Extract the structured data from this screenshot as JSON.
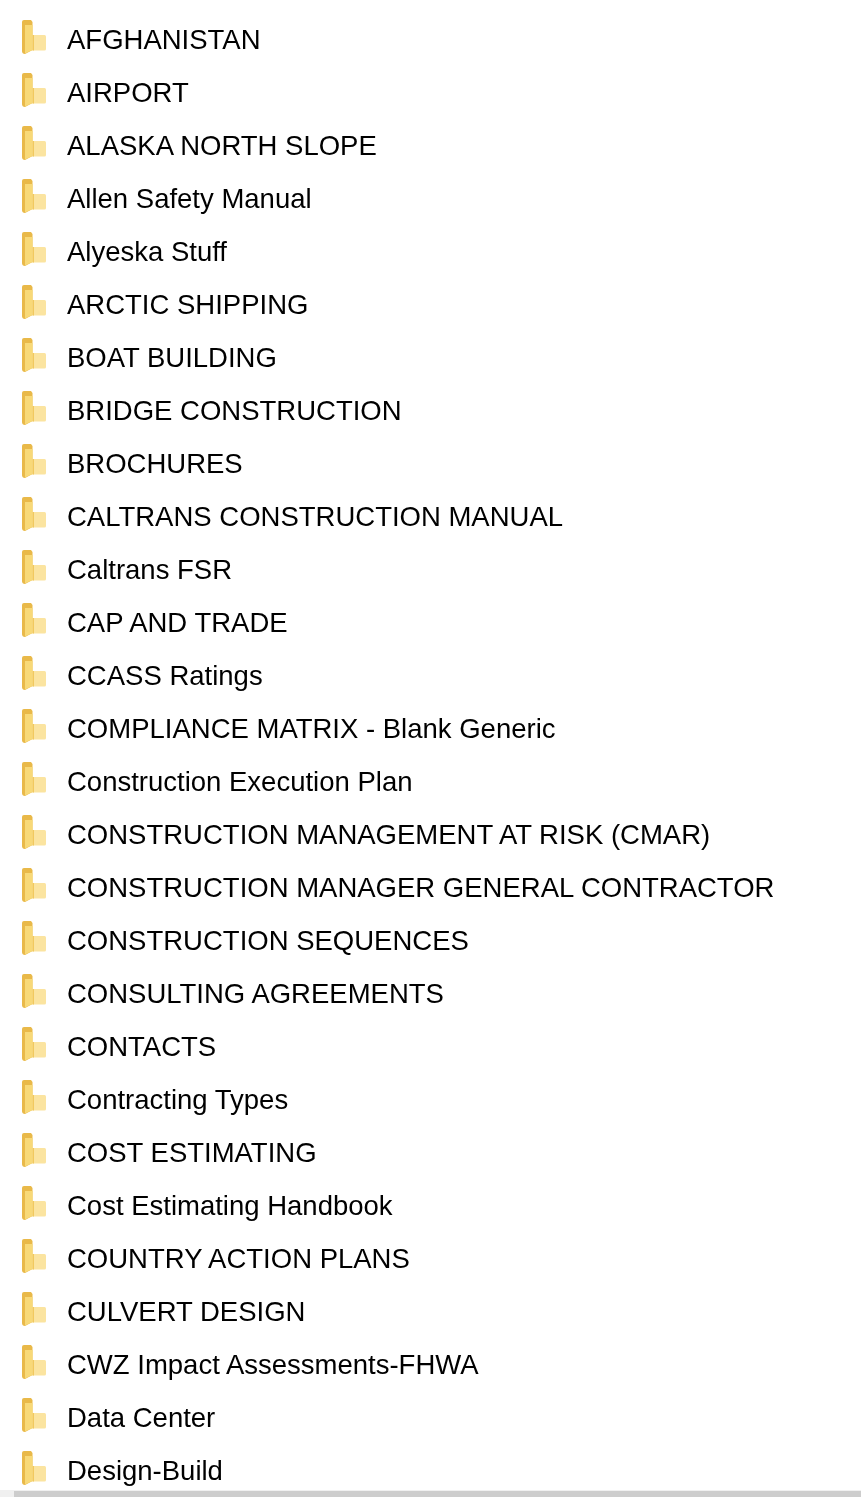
{
  "folders": [
    {
      "name": "AFGHANISTAN"
    },
    {
      "name": "AIRPORT"
    },
    {
      "name": "ALASKA NORTH SLOPE"
    },
    {
      "name": "Allen Safety Manual"
    },
    {
      "name": "Alyeska Stuff"
    },
    {
      "name": "ARCTIC SHIPPING"
    },
    {
      "name": "BOAT BUILDING"
    },
    {
      "name": "BRIDGE CONSTRUCTION"
    },
    {
      "name": "BROCHURES"
    },
    {
      "name": "CALTRANS CONSTRUCTION MANUAL"
    },
    {
      "name": "Caltrans FSR"
    },
    {
      "name": "CAP AND TRADE"
    },
    {
      "name": "CCASS Ratings"
    },
    {
      "name": "COMPLIANCE MATRIX - Blank Generic"
    },
    {
      "name": "Construction Execution Plan"
    },
    {
      "name": "CONSTRUCTION MANAGEMENT AT RISK (CMAR)"
    },
    {
      "name": "CONSTRUCTION MANAGER GENERAL CONTRACTOR"
    },
    {
      "name": "CONSTRUCTION SEQUENCES"
    },
    {
      "name": "CONSULTING AGREEMENTS"
    },
    {
      "name": "CONTACTS"
    },
    {
      "name": "Contracting Types"
    },
    {
      "name": "COST ESTIMATING"
    },
    {
      "name": "Cost Estimating Handbook"
    },
    {
      "name": "COUNTRY ACTION PLANS"
    },
    {
      "name": "CULVERT DESIGN"
    },
    {
      "name": "CWZ Impact Assessments-FHWA"
    },
    {
      "name": "Data Center"
    },
    {
      "name": "Design-Build"
    }
  ]
}
